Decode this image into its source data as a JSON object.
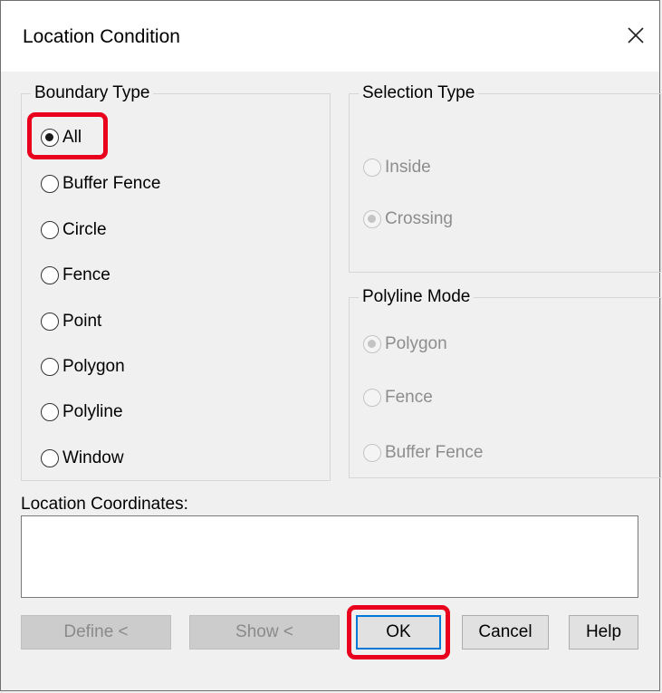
{
  "window": {
    "title": "Location Condition"
  },
  "boundary_type": {
    "legend": "Boundary Type",
    "options": [
      "All",
      "Buffer Fence",
      "Circle",
      "Fence",
      "Point",
      "Polygon",
      "Polyline",
      "Window"
    ],
    "selected": "All"
  },
  "selection_type": {
    "legend": "Selection Type",
    "options": [
      "Inside",
      "Crossing"
    ],
    "selected": "Crossing",
    "disabled": true
  },
  "polyline_mode": {
    "legend": "Polyline Mode",
    "options": [
      "Polygon",
      "Fence",
      "Buffer Fence"
    ],
    "selected": "Polygon",
    "disabled": true
  },
  "coordinates": {
    "label": "Location Coordinates:",
    "value": ""
  },
  "buttons": {
    "define": "Define <",
    "show": "Show <",
    "ok": "OK",
    "cancel": "Cancel",
    "help": "Help"
  },
  "colors": {
    "highlight": "#e8001c",
    "default_button_border": "#0078d7"
  },
  "icons": {
    "close": "close-icon"
  }
}
